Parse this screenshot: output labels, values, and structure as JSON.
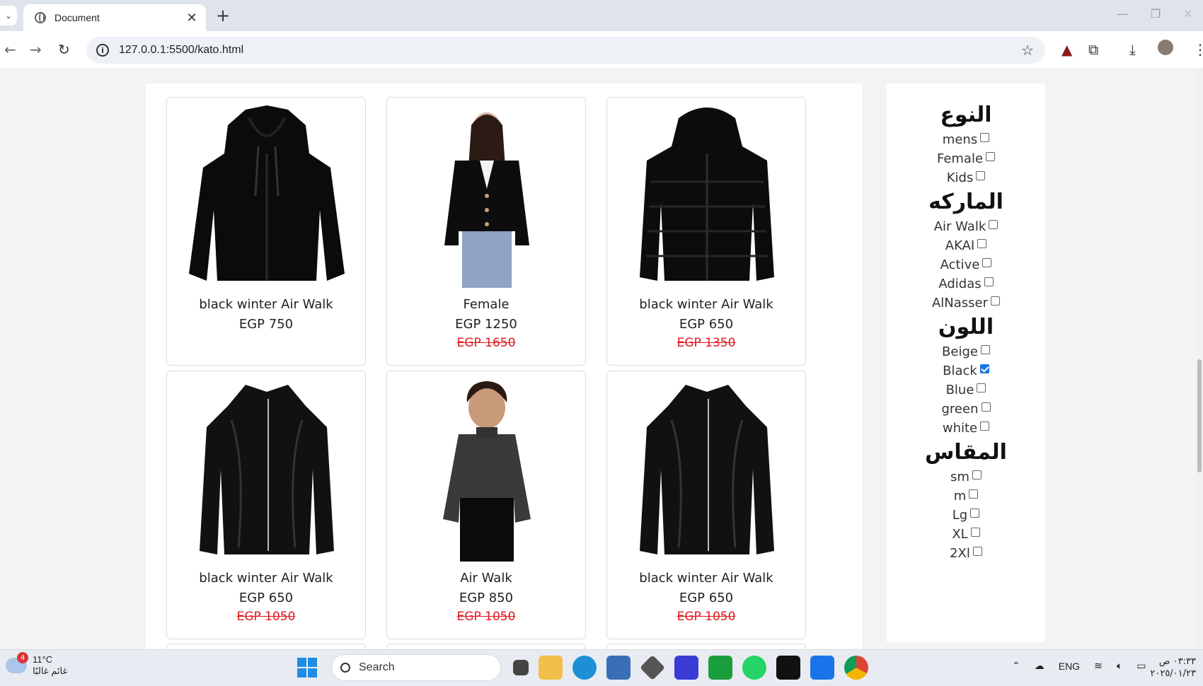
{
  "browser": {
    "tab_title": "Document",
    "tab_close": "✕",
    "new_tab": "+",
    "url": "127.0.0.1:5500/kato.html",
    "tab_dropdown": "⌄"
  },
  "products": [
    {
      "name": "black winter Air Walk",
      "price": "EGP 750",
      "old_price": "",
      "image": "black-hoodie"
    },
    {
      "name": "Female",
      "price": "EGP 1250",
      "old_price": "EGP 1650",
      "image": "female-cardigan"
    },
    {
      "name": "black winter Air Walk",
      "price": "EGP 650",
      "old_price": "EGP 1350",
      "image": "black-puffer-jacket"
    },
    {
      "name": "black winter Air Walk",
      "price": "EGP 650",
      "old_price": "EGP 1050",
      "image": "black-leather-jacket"
    },
    {
      "name": "Air Walk",
      "price": "EGP 850",
      "old_price": "EGP 1050",
      "image": "kid-turtleneck"
    },
    {
      "name": "black winter Air Walk",
      "price": "EGP 650",
      "old_price": "EGP 1050",
      "image": "black-leather-jacket"
    }
  ],
  "filters": {
    "type": {
      "heading": "النوع",
      "items": [
        {
          "label": "mens",
          "checked": false
        },
        {
          "label": "Female",
          "checked": false
        },
        {
          "label": "Kids",
          "checked": false
        }
      ]
    },
    "brand": {
      "heading": "الماركه",
      "items": [
        {
          "label": "Air Walk",
          "checked": false
        },
        {
          "label": "AKAI",
          "checked": false
        },
        {
          "label": "Active",
          "checked": false
        },
        {
          "label": "Adidas",
          "checked": false
        },
        {
          "label": "AlNasser",
          "checked": false
        }
      ]
    },
    "color": {
      "heading": "اللون",
      "items": [
        {
          "label": "Beige",
          "checked": false
        },
        {
          "label": "Black",
          "checked": true
        },
        {
          "label": "Blue",
          "checked": false
        },
        {
          "label": "green",
          "checked": false
        },
        {
          "label": "white",
          "checked": false
        }
      ]
    },
    "size": {
      "heading": "المقاس",
      "items": [
        {
          "label": "sm",
          "checked": false
        },
        {
          "label": "m",
          "checked": false
        },
        {
          "label": "Lg",
          "checked": false
        },
        {
          "label": "XL",
          "checked": false
        },
        {
          "label": "2Xl",
          "checked": false
        }
      ]
    }
  },
  "taskbar": {
    "weather_temp": "11°C",
    "weather_desc": "غائم غالبًا",
    "weather_badge": "4",
    "search_label": "Search",
    "lang": "ENG",
    "time": "٠٣:٣٣ ص",
    "date": "٢٠٢٥/٠١/٢٣"
  },
  "colors": {
    "accent": "#1a73e8",
    "sale_red": "#e0191f"
  }
}
